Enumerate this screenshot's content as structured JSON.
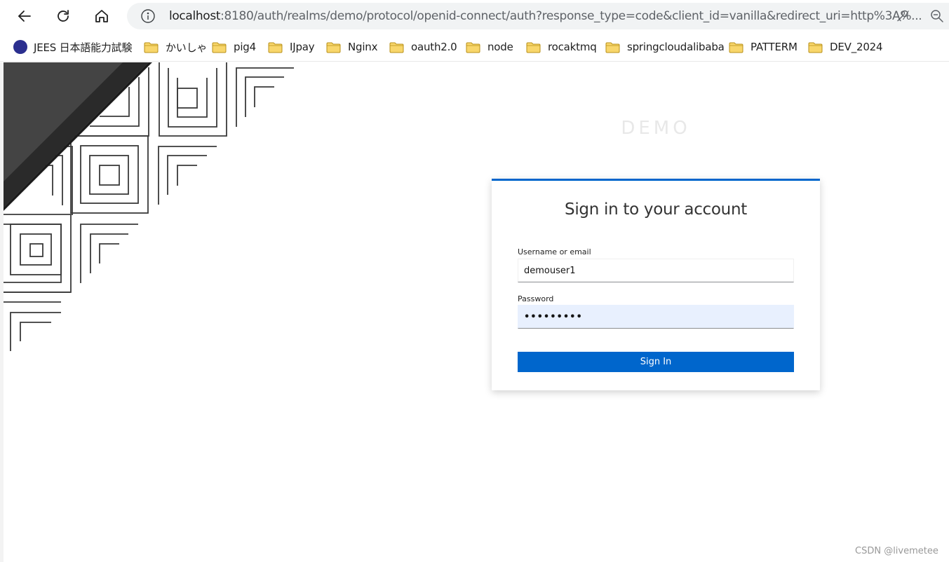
{
  "browser": {
    "url_host": "localhost",
    "url_rest": ":8180/auth/realms/demo/protocol/openid-connect/auth?response_type=code&client_id=vanilla&redirect_uri=http%3A%...",
    "icons": [
      "back-icon",
      "reload-icon",
      "home-icon",
      "info-icon",
      "key-icon",
      "zoom-icon"
    ]
  },
  "bookmarks": [
    {
      "label": "JEES 日本語能力試験",
      "icon": "jees-icon"
    },
    {
      "label": "かいしゃ",
      "icon": "folder-icon"
    },
    {
      "label": "pig4",
      "icon": "folder-icon"
    },
    {
      "label": "IJpay",
      "icon": "folder-icon"
    },
    {
      "label": "Nginx",
      "icon": "folder-icon"
    },
    {
      "label": "oauth2.0",
      "icon": "folder-icon"
    },
    {
      "label": "node",
      "icon": "folder-icon"
    },
    {
      "label": "rocaktmq",
      "icon": "folder-icon"
    },
    {
      "label": "springcloudalibaba",
      "icon": "folder-icon"
    },
    {
      "label": "PATTERM",
      "icon": "folder-icon"
    },
    {
      "label": "DEV_2024",
      "icon": "folder-icon"
    }
  ],
  "realm": {
    "title": "DEMO"
  },
  "login": {
    "heading": "Sign in to your account",
    "username_label": "Username or email",
    "username_value": "demouser1",
    "password_label": "Password",
    "password_value": "•••••••••",
    "submit_label": "Sign In"
  },
  "colors": {
    "accent": "#0066cc",
    "autofill": "#e8f0fe"
  },
  "watermark": "CSDN @livemetee"
}
